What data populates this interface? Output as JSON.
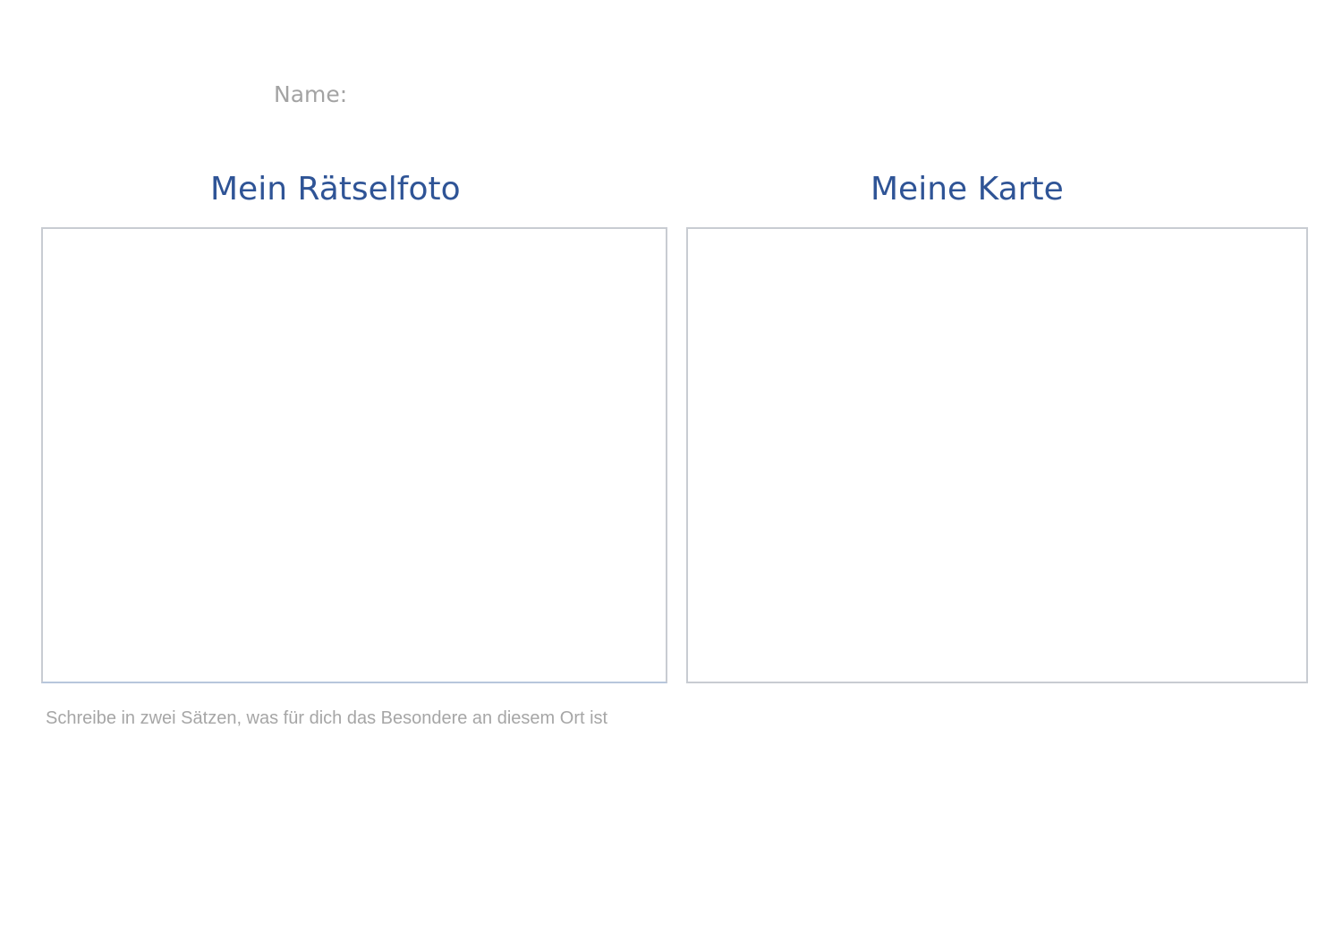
{
  "header": {
    "name_label": "Name:"
  },
  "photo_section": {
    "title": "Mein Rätselfoto"
  },
  "map_section": {
    "title": "Meine Karte"
  },
  "prompt": {
    "text": "Schreibe in zwei Sätzen, was für dich das Besondere an diesem Ort ist"
  },
  "colors": {
    "heading": "#2f5496",
    "label": "#a3a3a3",
    "frame_border": "#c8ccd2"
  }
}
